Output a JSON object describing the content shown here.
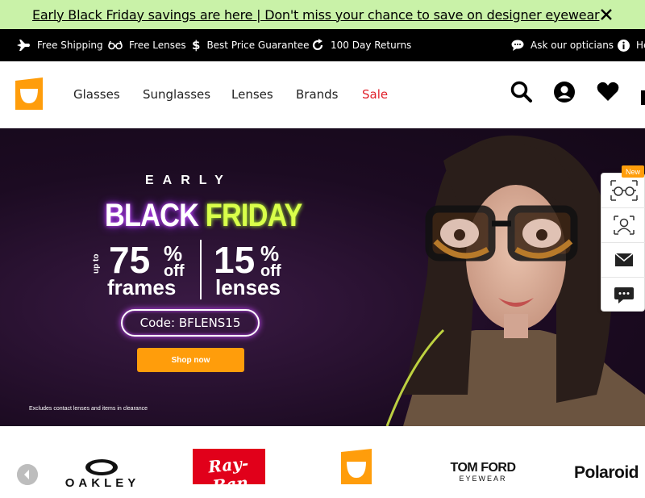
{
  "announcement": {
    "text": "Early Black Friday savings are here | Don't miss your chance to save on designer eyewear"
  },
  "utility_bar": {
    "items": [
      {
        "label": "Free Shipping",
        "icon": "plane-icon"
      },
      {
        "label": "Free Lenses",
        "icon": "glasses-icon"
      },
      {
        "label": "Best Price Guarantee",
        "icon": "dollar-icon"
      },
      {
        "label": "100 Day Returns",
        "icon": "return-icon"
      }
    ],
    "ask": "Ask our opticians",
    "help": "He"
  },
  "nav": {
    "items": [
      "Glasses",
      "Sunglasses",
      "Lenses",
      "Brands",
      "Sale"
    ]
  },
  "hero": {
    "early": "EARLY",
    "black": "BLACK",
    "friday": "FRIDAY",
    "upto": "up to",
    "frames_pct": "75",
    "lenses_pct": "15",
    "pct_sign": "%",
    "off": "off",
    "frames": "frames",
    "lenses": "lenses",
    "code": "Code: BFLENS15",
    "cta": "Shop now",
    "disclaimer": "Excludes contact lenses and items in clearance"
  },
  "side_widgets": {
    "new_badge": "New"
  },
  "brands": {
    "items": [
      "Oakley",
      "Ray-Ban",
      "Tom Ford Eyewear",
      "Polaroid"
    ],
    "tomford_line1": "TOM FORD",
    "tomford_line2": "EYEWEAR",
    "oakley": "OAKLEY",
    "rayban": "Ray-Ban",
    "polaroid": "Polaroid"
  },
  "colors": {
    "announce_bg": "#c9f2a8",
    "accent_orange": "#ff9d0b",
    "sale_red": "#e0202a"
  }
}
